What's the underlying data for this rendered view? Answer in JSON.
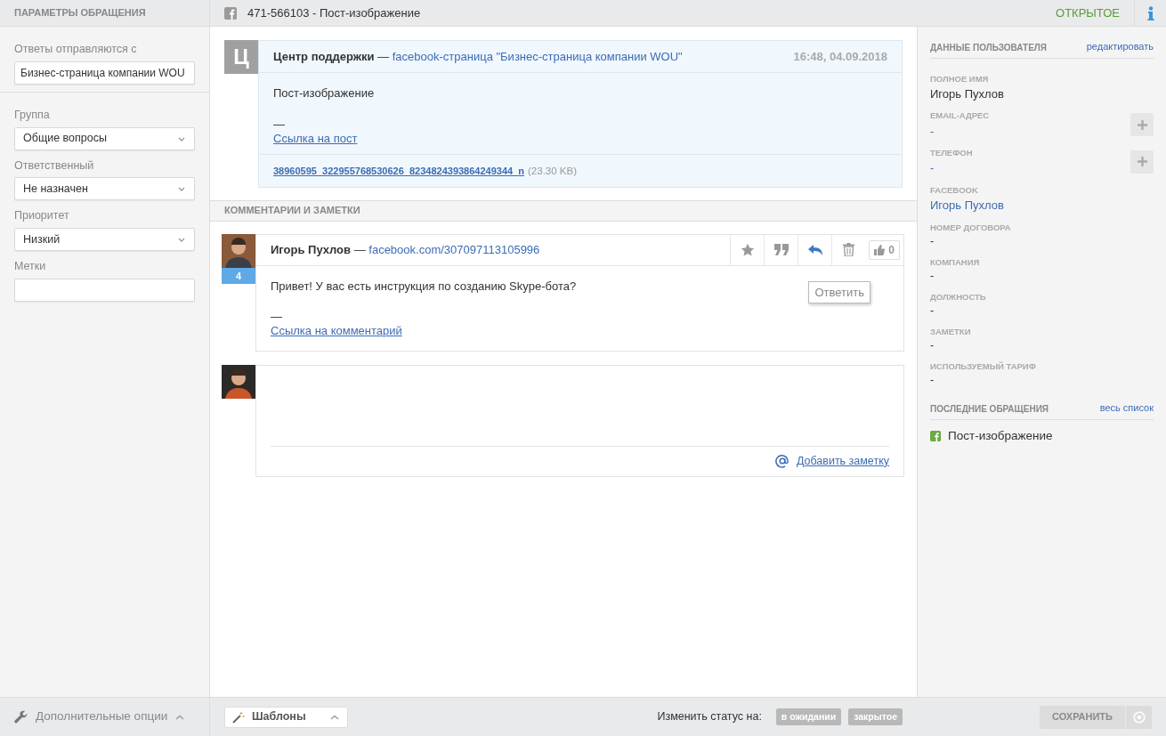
{
  "left_panel": {
    "title": "ПАРАМЕТРЫ ОБРАЩЕНИЯ",
    "reply_from": {
      "label": "Ответы отправляются с",
      "value": "Бизнес-страница компании WOU"
    },
    "fields": [
      {
        "label": "Группа",
        "kind": "select",
        "value": "Общие вопросы"
      },
      {
        "label": "Ответственный",
        "kind": "select",
        "value": "Не назначен"
      },
      {
        "label": "Приоритет",
        "kind": "select",
        "value": "Низкий"
      },
      {
        "label": "Метки",
        "kind": "input"
      }
    ],
    "more_options": "Дополнительные опции"
  },
  "ticket": {
    "title": "471-566103 - Пост-изображение",
    "status": "ОТКРЫТОЕ"
  },
  "post": {
    "avatar_letter": "Ц",
    "author": "Центр поддержки",
    "dash": "—",
    "source": "facebook-страница \"Бизнес-страница компании WOU\"",
    "time": "16:48, 04.09.2018",
    "text": "Пост-изображение",
    "separator": "—",
    "link": "Ссылка на пост",
    "attachment": {
      "name": "38960595_322955768530626_8234824393864249344_n",
      "size": "(23.30 KB)"
    }
  },
  "comments_title": "КОММЕНТАРИИ И ЗАМЕТКИ",
  "comment": {
    "author": "Игорь Пухлов",
    "dash": "—",
    "source": "facebook.com/307097113105996",
    "badge": "4",
    "text": "Привет! У вас есть инструкция по созданию Skype-бота?",
    "separator": "—",
    "link": "Ссылка на комментарий",
    "likes": "0",
    "tooltip": "Ответить"
  },
  "reply_box": {
    "add_note": "Добавить заметку"
  },
  "user_panel": {
    "title": "ДАННЫЕ ПОЛЬЗОВАТЕЛЯ",
    "edit": "редактировать",
    "fields": [
      {
        "label": "ПОЛНОЕ ИМЯ",
        "value": "Игорь Пухлов",
        "kind": "text"
      },
      {
        "label": "EMAIL-АДРЕС",
        "value": "-",
        "kind": "addable"
      },
      {
        "label": "ТЕЛЕФОН",
        "value": "-",
        "kind": "addable"
      },
      {
        "label": "FACEBOOK",
        "value": "Игорь Пухлов",
        "kind": "link"
      },
      {
        "label": "НОМЕР ДОГОВОРА",
        "value": "-",
        "kind": "text"
      },
      {
        "label": "КОМПАНИЯ",
        "value": "-",
        "kind": "text"
      },
      {
        "label": "ДОЛЖНОСТЬ",
        "value": "-",
        "kind": "text"
      },
      {
        "label": "ЗАМЕТКИ",
        "value": "-",
        "kind": "text"
      },
      {
        "label": "ИСПОЛЬЗУЕМЫЙ ТАРИФ",
        "value": "-",
        "kind": "text"
      }
    ],
    "recent_title": "ПОСЛЕДНИЕ ОБРАЩЕНИЯ",
    "all_link": "весь список",
    "recent": [
      {
        "text": "Пост-изображение"
      }
    ]
  },
  "footer": {
    "templates": "Шаблоны",
    "status_label": "Изменить статус на:",
    "status_buttons": [
      "в ожидании",
      "закрытое"
    ],
    "save": "СОХРАНИТЬ"
  }
}
